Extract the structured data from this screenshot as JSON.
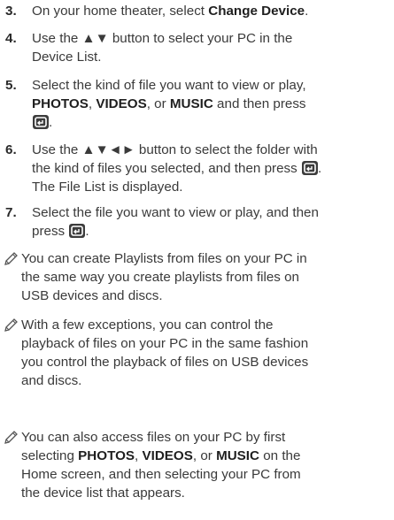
{
  "steps": [
    {
      "number": "3.",
      "parts": [
        "On your home theater, select ",
        "Change Device",
        "."
      ]
    },
    {
      "number": "4.",
      "parts": [
        "Use the ▲▼ button to select your PC in the",
        "Device List."
      ]
    },
    {
      "number": "5.",
      "parts": [
        "Select the kind of file you want to view or play,",
        "PHOTOS",
        ", ",
        "VIDEOS",
        ", or ",
        "MUSIC",
        " and then press",
        "."
      ]
    },
    {
      "number": "6.",
      "parts": [
        "Use the ▲▼◄► button to select the folder with",
        "the kind of files you selected, and then press",
        ".",
        "The File List is displayed."
      ]
    },
    {
      "number": "7.",
      "parts": [
        "Select the file you want to view or play, and then",
        "press",
        "."
      ]
    }
  ],
  "notes": [
    {
      "lines": [
        "You can create Playlists from files on your PC in",
        "the same way you create playlists from files on",
        "USB devices and discs."
      ]
    },
    {
      "lines": [
        "With a few exceptions, you can control the",
        "playback of files on your PC in the same fashion",
        "you control the playback of files on USB devices",
        "and discs."
      ]
    },
    {
      "parts": [
        "You can also access files on your PC by first",
        "selecting ",
        "PHOTOS",
        ", ",
        "VIDEOS",
        ", or ",
        "MUSIC",
        " on the",
        "Home screen, and then selecting your PC from",
        "the device list that appears."
      ]
    }
  ],
  "icons": {
    "enter": "enter-button-icon",
    "note": "pencil-note-icon"
  },
  "colors": {
    "text": "#3a3a3a",
    "bold": "#1f1f1f",
    "icon_bg": "#3c3c3c"
  }
}
